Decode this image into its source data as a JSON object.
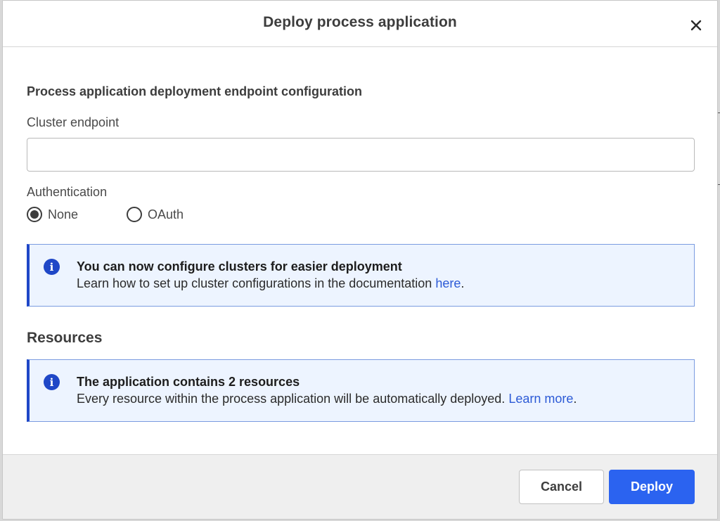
{
  "dialog": {
    "title": "Deploy process application",
    "close_icon": "close-icon"
  },
  "endpoint_section": {
    "title": "Process application deployment endpoint configuration",
    "cluster_endpoint_label": "Cluster endpoint",
    "cluster_endpoint_value": "",
    "authentication_label": "Authentication",
    "auth_options": [
      {
        "label": "None",
        "selected": true
      },
      {
        "label": "OAuth",
        "selected": false
      }
    ]
  },
  "cluster_notice": {
    "icon": "info-icon",
    "title": "You can now configure clusters for easier deployment",
    "body": "Learn how to set up cluster configurations in the documentation ",
    "link_text": "here",
    "suffix": "."
  },
  "resources_section": {
    "title": "Resources",
    "notice": {
      "icon": "info-icon",
      "title": "The application contains 2 resources",
      "body": "Every resource within the process application will be automatically deployed. ",
      "link_text": "Learn more",
      "suffix": "."
    }
  },
  "footer": {
    "cancel_label": "Cancel",
    "deploy_label": "Deploy"
  },
  "colors": {
    "primary": "#2b63f0",
    "notice_bg": "#edf4ff",
    "notice_accent": "#1f47c7",
    "link": "#2c5ad6"
  }
}
